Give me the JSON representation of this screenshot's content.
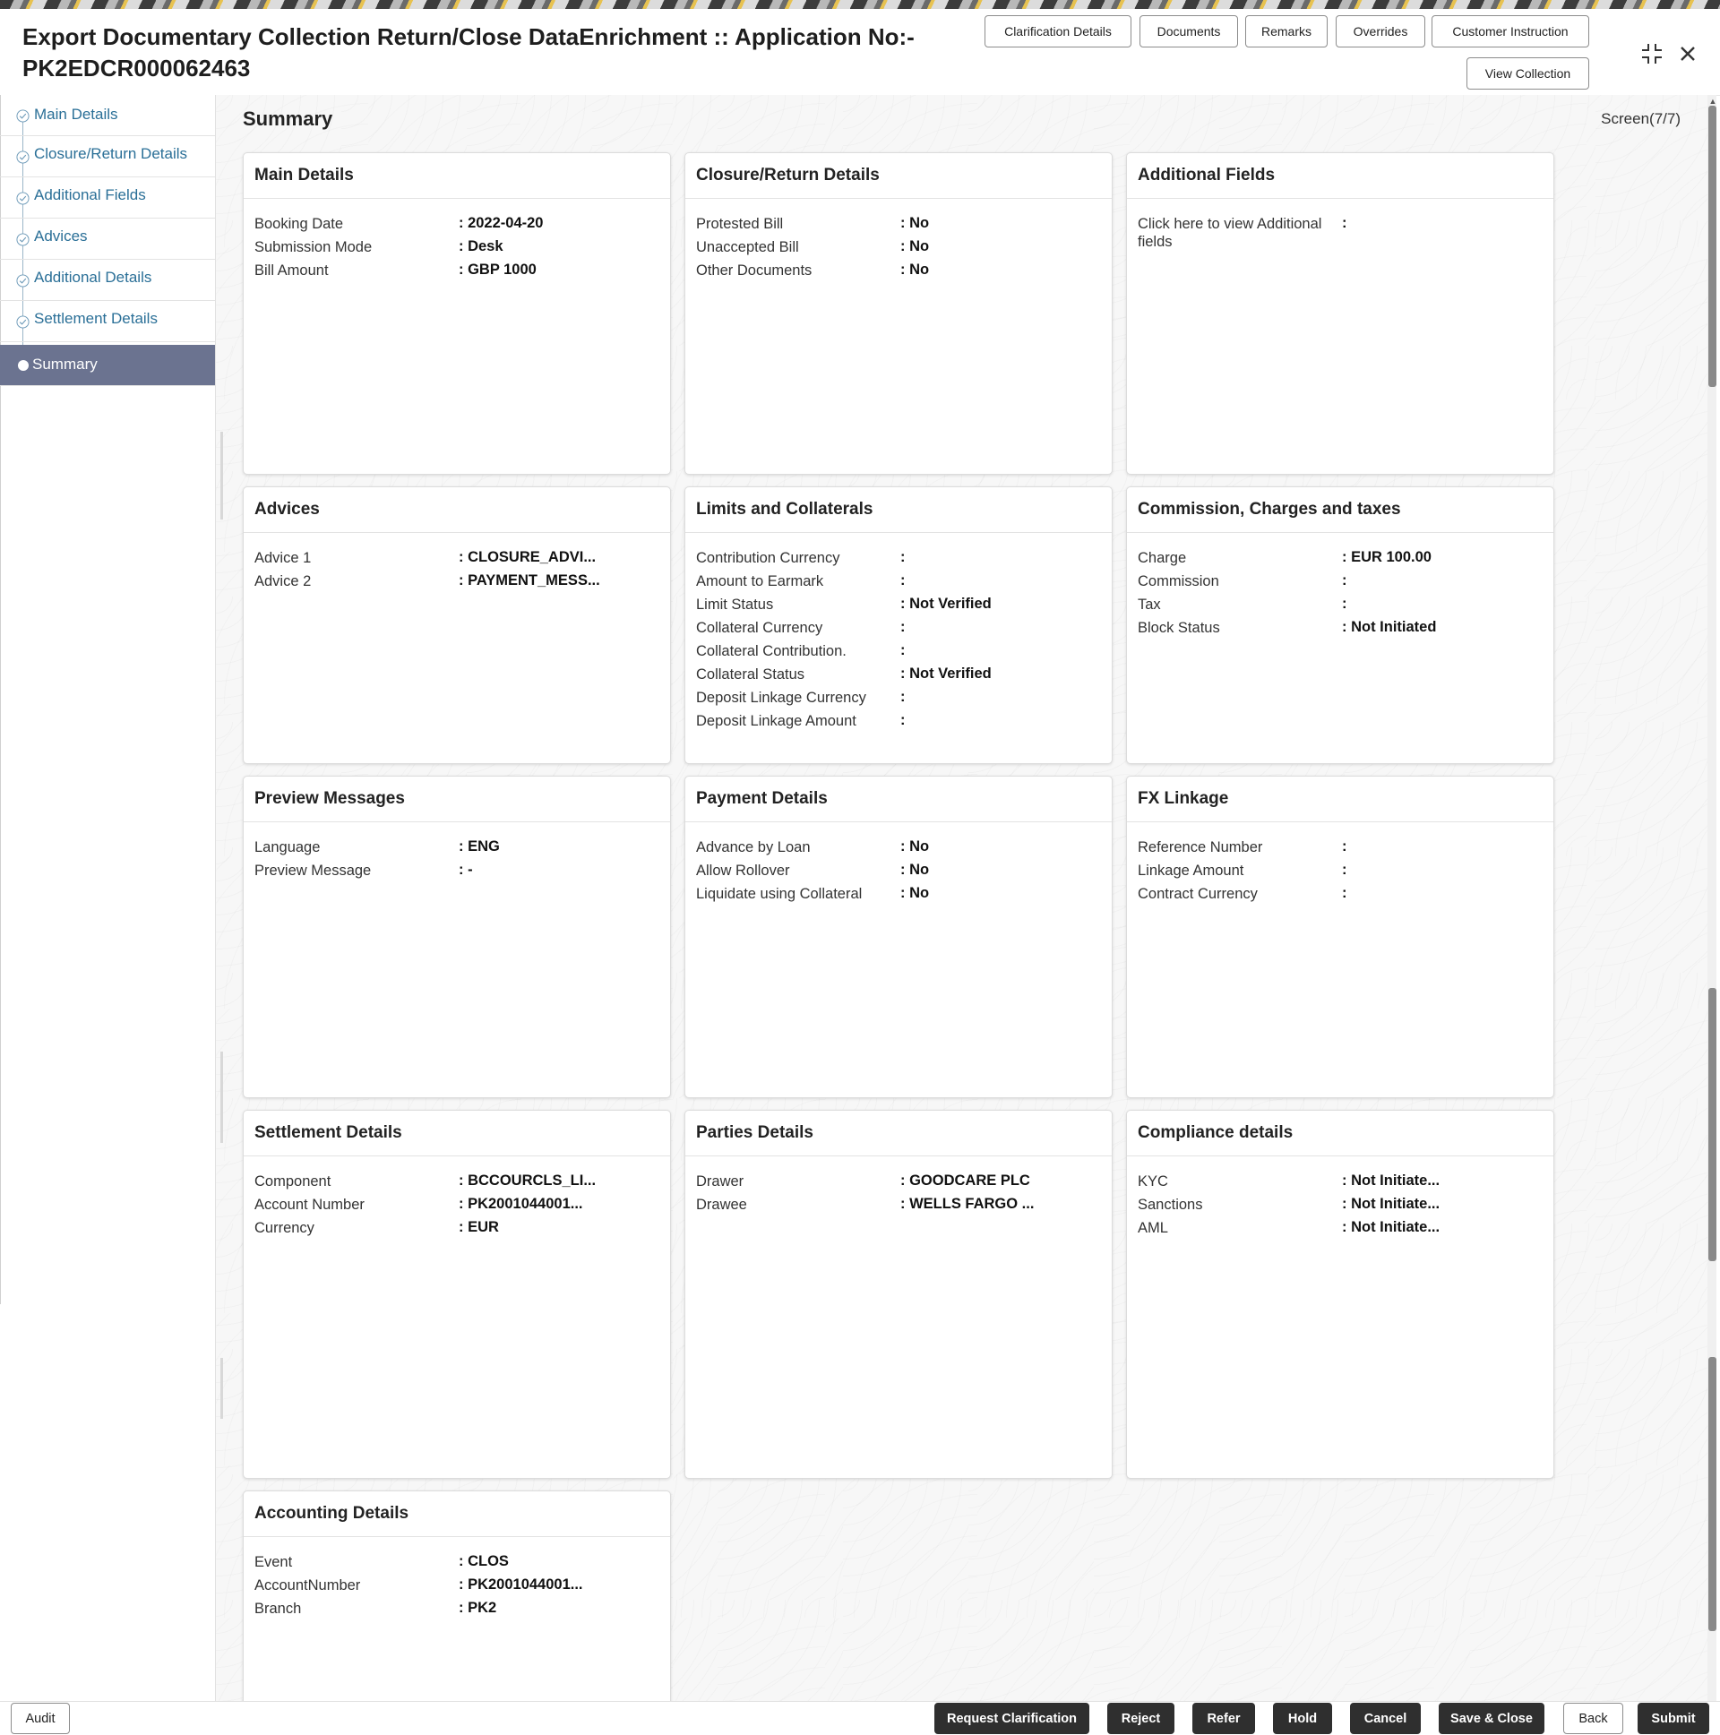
{
  "header": {
    "title": "Export Documentary Collection Return/Close DataEnrichment :: Application No:- PK2EDCR000062463",
    "buttons": {
      "clarification": "Clarification Details",
      "documents": "Documents",
      "remarks": "Remarks",
      "overrides": "Overrides",
      "customer_instruction": "Customer Instruction",
      "view_collection": "View Collection"
    }
  },
  "sidebar": {
    "items": [
      {
        "label": "Main Details"
      },
      {
        "label": "Closure/Return Details"
      },
      {
        "label": "Additional Fields"
      },
      {
        "label": "Advices"
      },
      {
        "label": "Additional Details"
      },
      {
        "label": "Settlement Details"
      },
      {
        "label": "Summary"
      }
    ]
  },
  "main": {
    "title": "Summary",
    "screen": "Screen(7/7)",
    "cards": {
      "main_details": {
        "title": "Main Details",
        "rows": [
          {
            "k": "Booking Date",
            "v": ": 2022-04-20"
          },
          {
            "k": "Submission Mode",
            "v": ": Desk"
          },
          {
            "k": "Bill Amount",
            "v": ": GBP 1000"
          }
        ]
      },
      "closure": {
        "title": "Closure/Return Details",
        "rows": [
          {
            "k": "Protested Bill",
            "v": ": No"
          },
          {
            "k": "Unaccepted Bill",
            "v": ": No"
          },
          {
            "k": "Other Documents",
            "v": ": No"
          }
        ]
      },
      "additional_fields": {
        "title": "Additional Fields",
        "rows": [
          {
            "k": "Click here to view Additional fields",
            "v": ":"
          }
        ]
      },
      "advices": {
        "title": "Advices",
        "rows": [
          {
            "k": "Advice 1",
            "v": ": CLOSURE_ADVI..."
          },
          {
            "k": "Advice 2",
            "v": ": PAYMENT_MESS..."
          }
        ]
      },
      "limits": {
        "title": "Limits and Collaterals",
        "rows": [
          {
            "k": "Contribution Currency",
            "v": ":"
          },
          {
            "k": "Amount to Earmark",
            "v": ":"
          },
          {
            "k": "Limit Status",
            "v": ": Not Verified"
          },
          {
            "k": "Collateral Currency",
            "v": ":"
          },
          {
            "k": "Collateral Contribution.",
            "v": ":"
          },
          {
            "k": "Collateral Status",
            "v": ": Not Verified"
          },
          {
            "k": "Deposit Linkage Currency",
            "v": ":"
          },
          {
            "k": "Deposit Linkage Amount",
            "v": ":"
          }
        ]
      },
      "commission": {
        "title": "Commission, Charges and taxes",
        "rows": [
          {
            "k": "Charge",
            "v": ": EUR  100.00"
          },
          {
            "k": "Commission",
            "v": ":"
          },
          {
            "k": "Tax",
            "v": ":"
          },
          {
            "k": "Block Status",
            "v": ": Not Initiated"
          }
        ]
      },
      "preview": {
        "title": "Preview Messages",
        "rows": [
          {
            "k": "Language",
            "v": ": ENG"
          },
          {
            "k": "Preview Message",
            "v": ": -"
          }
        ]
      },
      "payment": {
        "title": "Payment Details",
        "rows": [
          {
            "k": "Advance by Loan",
            "v": ": No"
          },
          {
            "k": "Allow Rollover",
            "v": ": No"
          },
          {
            "k": "Liquidate using Collateral",
            "v": ": No"
          }
        ]
      },
      "fx": {
        "title": "FX Linkage",
        "rows": [
          {
            "k": "Reference Number",
            "v": ":"
          },
          {
            "k": "Linkage Amount",
            "v": ":"
          },
          {
            "k": "Contract Currency",
            "v": ":"
          }
        ]
      },
      "settlement": {
        "title": "Settlement Details",
        "rows": [
          {
            "k": "Component",
            "v": ": BCCOURCLS_LI..."
          },
          {
            "k": "Account Number",
            "v": ": PK2001044001..."
          },
          {
            "k": "Currency",
            "v": ": EUR"
          }
        ]
      },
      "parties": {
        "title": "Parties Details",
        "rows": [
          {
            "k": "Drawer",
            "v": ": GOODCARE PLC"
          },
          {
            "k": "Drawee",
            "v": ": WELLS FARGO ..."
          }
        ]
      },
      "compliance": {
        "title": "Compliance details",
        "rows": [
          {
            "k": "KYC",
            "v": ": Not Initiate..."
          },
          {
            "k": "Sanctions",
            "v": ": Not Initiate..."
          },
          {
            "k": "AML",
            "v": ": Not Initiate..."
          }
        ]
      },
      "accounting": {
        "title": "Accounting Details",
        "rows": [
          {
            "k": "Event",
            "v": ": CLOS"
          },
          {
            "k": "AccountNumber",
            "v": ": PK2001044001..."
          },
          {
            "k": "Branch",
            "v": ": PK2"
          }
        ]
      }
    }
  },
  "footer": {
    "audit": "Audit",
    "request_clarification": "Request Clarification",
    "reject": "Reject",
    "refer": "Refer",
    "hold": "Hold",
    "cancel": "Cancel",
    "save_close": "Save & Close",
    "back": "Back",
    "submit": "Submit"
  },
  "colors": {
    "active_nav_bg": "#6b7390",
    "nav_link": "#2a6f97",
    "dark_button": "#2f2f2f"
  },
  "icons": {
    "minimize": "collapse-icon",
    "close": "close-icon",
    "nav_check": "check-circle-icon"
  }
}
